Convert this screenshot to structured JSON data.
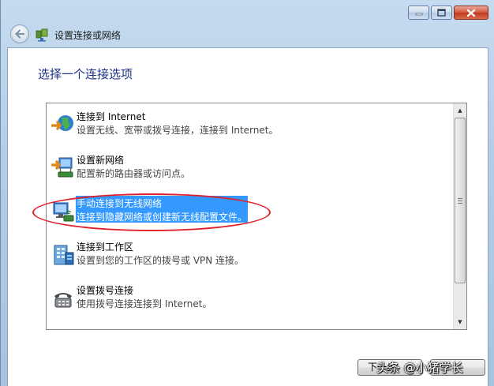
{
  "window": {
    "nav_title": "设置连接或网络"
  },
  "content": {
    "heading": "选择一个连接选项"
  },
  "options": [
    {
      "title": "连接到 Internet",
      "desc": "设置无线、宽带或拨号连接，连接到 Internet。",
      "icon": "internet-globe-icon"
    },
    {
      "title": "设置新网络",
      "desc": "配置新的路由器或访问点。",
      "icon": "new-network-router-icon"
    },
    {
      "title": "手动连接到无线网络",
      "desc": "连接到隐藏网络或创建新无线配置文件。",
      "icon": "wireless-network-icon",
      "selected": true
    },
    {
      "title": "连接到工作区",
      "desc": "设置到您的工作区的拨号或 VPN 连接。",
      "icon": "workplace-building-icon"
    },
    {
      "title": "设置拨号连接",
      "desc": "使用拨号连接连接到 Internet。",
      "icon": "dialup-phone-icon"
    }
  ],
  "buttons": {
    "next_label": "下一步"
  },
  "watermark": {
    "text": "头条 @小猪学长"
  },
  "colors": {
    "heading": "#1e3287",
    "selection": "#3399ff",
    "annotation_oval": "#e0202a"
  }
}
